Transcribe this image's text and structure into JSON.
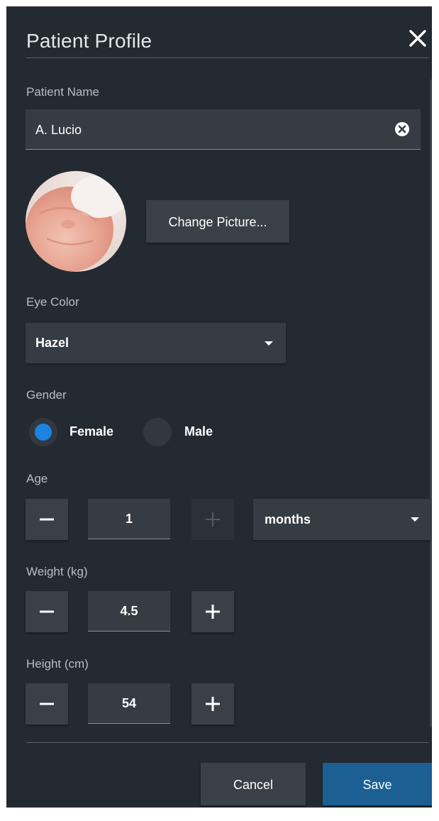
{
  "dialog": {
    "title": "Patient Profile"
  },
  "patient_name": {
    "label": "Patient Name",
    "value": "A. Lucio"
  },
  "picture": {
    "button_label": "Change Picture..."
  },
  "eye_color": {
    "label": "Eye Color",
    "selected": "Hazel"
  },
  "gender": {
    "label": "Gender",
    "options": [
      "Female",
      "Male"
    ],
    "selected": "Female"
  },
  "age": {
    "label": "Age",
    "value": "1",
    "unit": "months"
  },
  "weight": {
    "label": "Weight (kg)",
    "value": "4.5"
  },
  "height": {
    "label": "Height (cm)",
    "value": "54"
  },
  "actions": {
    "cancel_label": "Cancel",
    "save_label": "Save"
  },
  "icons": {
    "close": "close-icon",
    "clear": "clear-circle-icon",
    "dropdown": "chevron-down-icon",
    "minus": "minus-icon",
    "plus": "plus-icon"
  },
  "colors": {
    "panel_background": "#242a31",
    "field_background": "#363c43",
    "button_background": "#3a4047",
    "accent_blue": "#1c83e0",
    "save_button": "#1b5f93"
  }
}
